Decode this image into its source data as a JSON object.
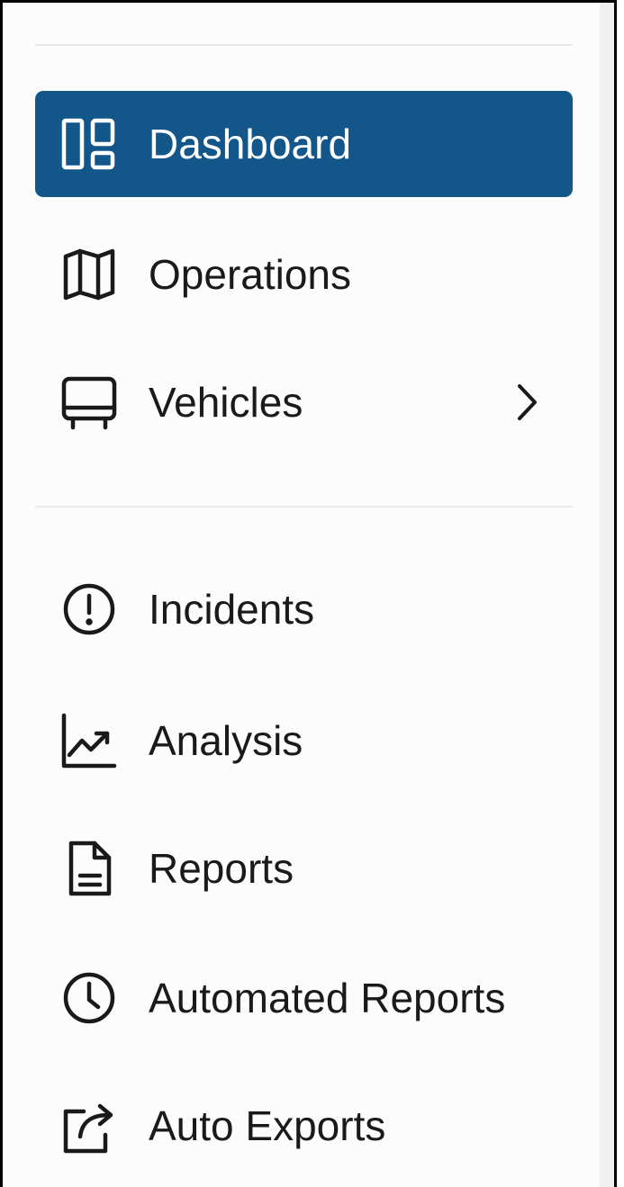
{
  "sidebar": {
    "primary_items": [
      {
        "label": "Dashboard",
        "icon": "dashboard-icon",
        "active": true
      },
      {
        "label": "Operations",
        "icon": "map-icon",
        "active": false
      },
      {
        "label": "Vehicles",
        "icon": "bus-icon",
        "active": false,
        "has_submenu": true
      }
    ],
    "secondary_items": [
      {
        "label": "Incidents",
        "icon": "alert-circle-icon"
      },
      {
        "label": "Analysis",
        "icon": "trend-chart-icon"
      },
      {
        "label": "Reports",
        "icon": "document-icon"
      },
      {
        "label": "Automated Reports",
        "icon": "clock-icon"
      },
      {
        "label": "Auto Exports",
        "icon": "export-icon"
      }
    ]
  },
  "colors": {
    "active_background": "#13578a",
    "active_text": "#ffffff",
    "text": "#1a1a1a",
    "divider": "#e9e9e9"
  }
}
